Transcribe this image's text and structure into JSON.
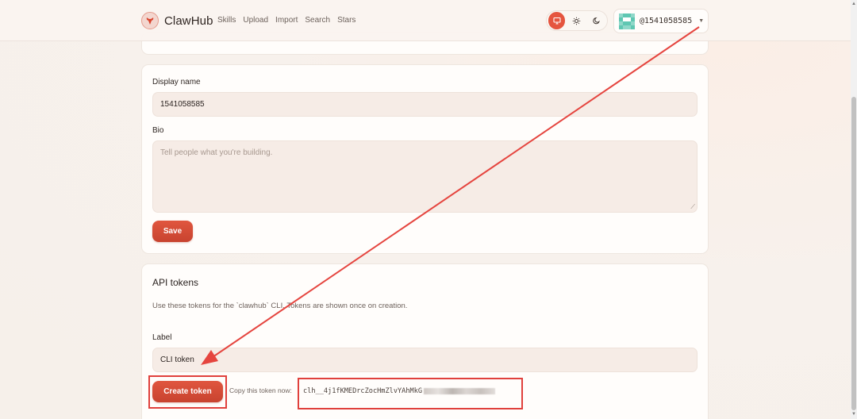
{
  "app": {
    "name": "ClawHub"
  },
  "nav": {
    "items": [
      "Skills",
      "Upload",
      "Import",
      "Search",
      "Stars"
    ]
  },
  "theme": {
    "options": [
      "monitor-icon",
      "sun-icon",
      "moon-icon"
    ],
    "active": "monitor-icon",
    "accent": "#e5553f"
  },
  "user": {
    "handle": "@1541058585"
  },
  "profile": {
    "display_name_label": "Display name",
    "display_name_value": "1541058585",
    "bio_label": "Bio",
    "bio_placeholder": "Tell people what you're building.",
    "save_label": "Save"
  },
  "tokens": {
    "title": "API tokens",
    "description": "Use these tokens for the `clawhub` CLI. Tokens are shown once on creation.",
    "label_label": "Label",
    "label_value": "CLI token",
    "create_label": "Create token",
    "copy_prompt": "Copy this token now:",
    "token_value": "clh__4j1fKMEDrcZocHmZlvYAhMkG"
  },
  "colors": {
    "highlight": "#e0403c",
    "button": "#d14d37"
  }
}
